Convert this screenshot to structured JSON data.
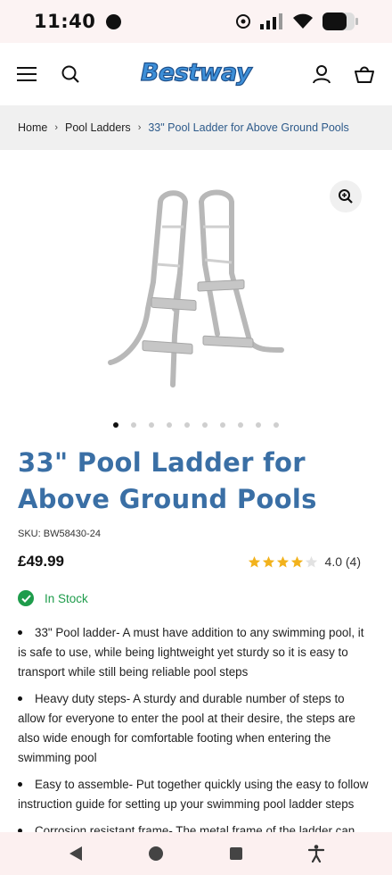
{
  "status_bar": {
    "time": "11:40"
  },
  "header": {
    "logo_text": "Bestway"
  },
  "breadcrumb": {
    "items": [
      "Home",
      "Pool Ladders",
      "33\" Pool Ladder for Above Ground Pools"
    ]
  },
  "gallery": {
    "dot_count": 10,
    "active_index": 0
  },
  "product": {
    "title": "33\" Pool Ladder for Above Ground Pools",
    "sku": "SKU: BW58430-24",
    "price": "£49.99",
    "rating_value": 4.0,
    "rating_text": "4.0 (4)",
    "stock": "In Stock",
    "features": [
      "33\" Pool ladder- A must have addition to any swimming pool, it is safe to use, while being lightweight yet sturdy so it is easy to transport while still being reliable pool steps",
      "Heavy duty steps- A sturdy and durable number of steps to allow for everyone to enter the pool at their desire, the steps are also wide enough for comfortable footing when entering the swimming pool",
      "Easy to assemble- Put together quickly using the easy to follow instruction guide for setting up your swimming pool ladder steps",
      "Corrosion resistant frame- The metal frame of the ladder can withstand the elements for continued use through the seasons"
    ]
  },
  "colors": {
    "title": "#3a6fa5",
    "stock": "#1e9c4b",
    "star": "#f2b21c",
    "logo": "#3d8fd8"
  },
  "icons": [
    "menu-icon",
    "search-icon",
    "account-icon",
    "basket-icon",
    "zoom-in-icon",
    "check-icon",
    "back-icon",
    "home-icon",
    "recents-icon",
    "accessibility-icon"
  ]
}
